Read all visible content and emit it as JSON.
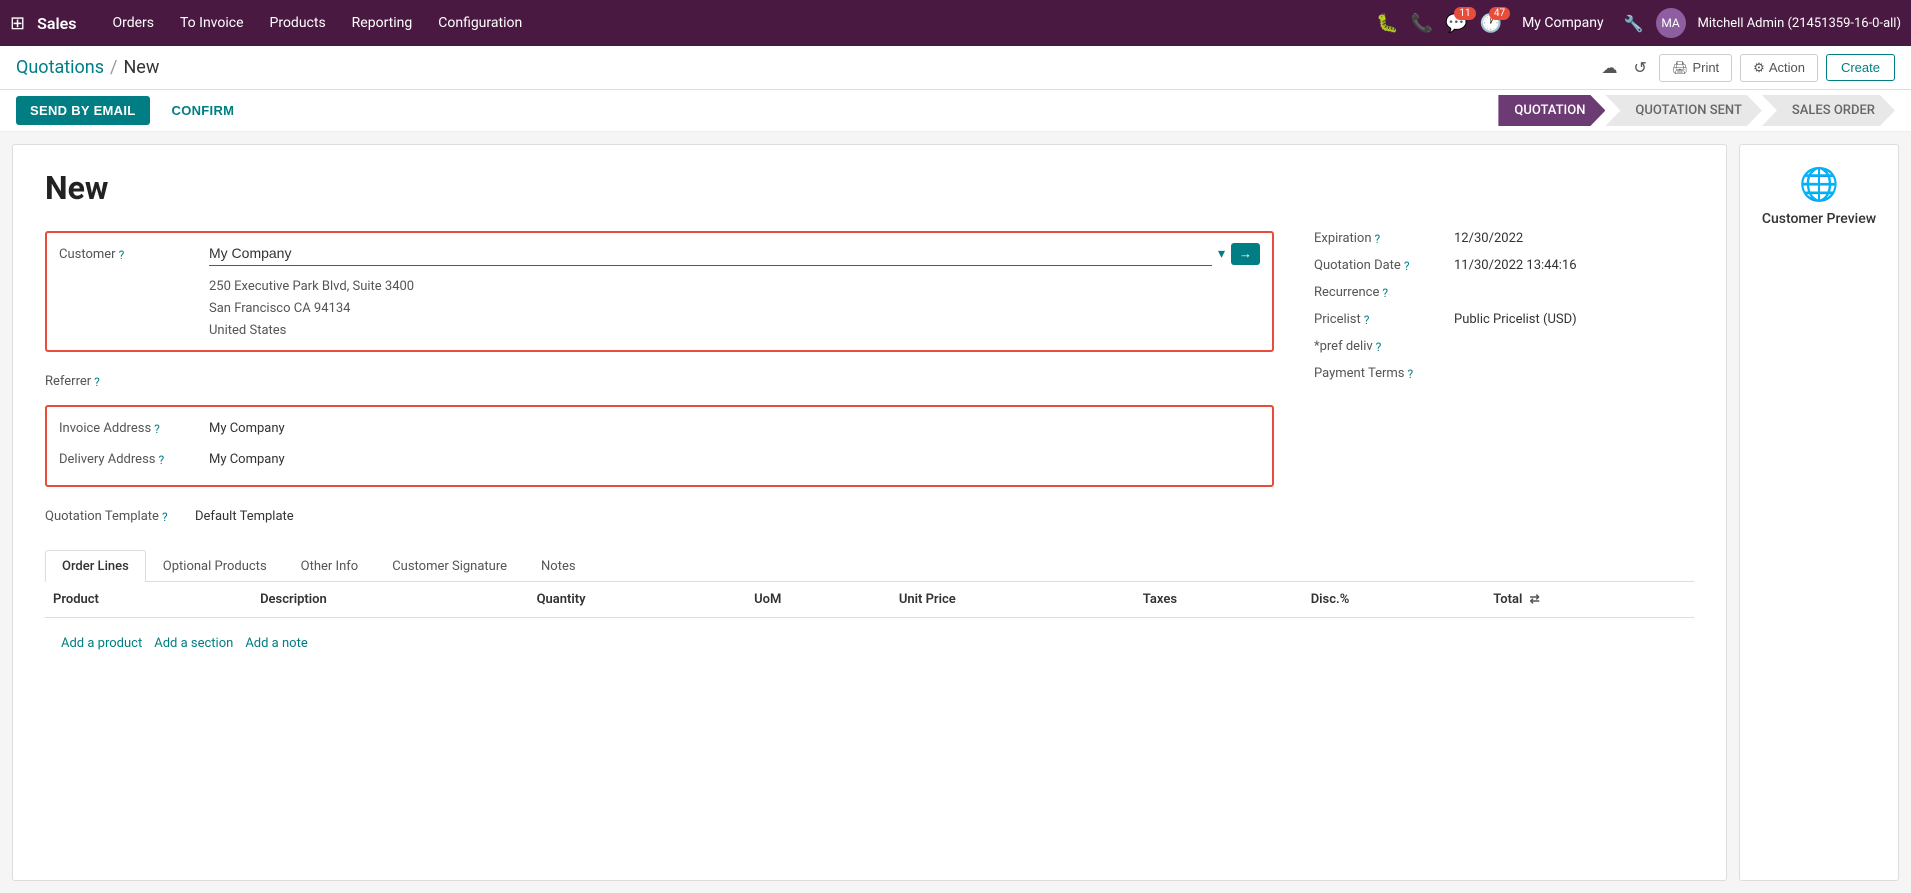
{
  "topnav": {
    "app_name": "Sales",
    "menu_items": [
      "Orders",
      "To Invoice",
      "Products",
      "Reporting",
      "Configuration"
    ],
    "company": "My Company",
    "username": "Mitchell Admin (21451359-16-0-all)",
    "chat_badge": "11",
    "activity_badge": "47"
  },
  "breadcrumb": {
    "parent": "Quotations",
    "separator": "/",
    "current": "New"
  },
  "action_bar": {
    "print_label": "Print",
    "action_label": "Action",
    "create_label": "Create"
  },
  "status_bar": {
    "send_email_label": "SEND BY EMAIL",
    "confirm_label": "CONFIRM",
    "steps": [
      {
        "label": "QUOTATION",
        "active": true
      },
      {
        "label": "QUOTATION SENT",
        "active": false
      },
      {
        "label": "SALES ORDER",
        "active": false
      }
    ]
  },
  "sidebar": {
    "customer_preview_label": "Customer Preview"
  },
  "form": {
    "title": "New",
    "customer_label": "Customer",
    "customer_value": "My Company",
    "customer_address_line1": "250 Executive Park Blvd, Suite 3400",
    "customer_address_line2": "San Francisco CA 94134",
    "customer_address_line3": "United States",
    "referrer_label": "Referrer",
    "invoice_address_label": "Invoice Address",
    "invoice_address_value": "My Company",
    "delivery_address_label": "Delivery Address",
    "delivery_address_value": "My Company",
    "quotation_template_label": "Quotation Template",
    "quotation_template_value": "Default Template",
    "expiration_label": "Expiration",
    "expiration_value": "12/30/2022",
    "quotation_date_label": "Quotation Date",
    "quotation_date_value": "11/30/2022 13:44:16",
    "recurrence_label": "Recurrence",
    "recurrence_value": "",
    "pricelist_label": "Pricelist",
    "pricelist_value": "Public Pricelist (USD)",
    "pref_deliv_label": "*pref deliv",
    "pref_deliv_value": "",
    "payment_terms_label": "Payment Terms",
    "payment_terms_value": ""
  },
  "tabs": [
    {
      "label": "Order Lines",
      "active": true
    },
    {
      "label": "Optional Products",
      "active": false
    },
    {
      "label": "Other Info",
      "active": false
    },
    {
      "label": "Customer Signature",
      "active": false
    },
    {
      "label": "Notes",
      "active": false
    }
  ],
  "table": {
    "columns": [
      "Product",
      "Description",
      "Quantity",
      "UoM",
      "Unit Price",
      "Taxes",
      "Disc.%",
      "Total"
    ],
    "actions": [
      {
        "label": "Add a product"
      },
      {
        "label": "Add a section"
      },
      {
        "label": "Add a note"
      }
    ]
  }
}
